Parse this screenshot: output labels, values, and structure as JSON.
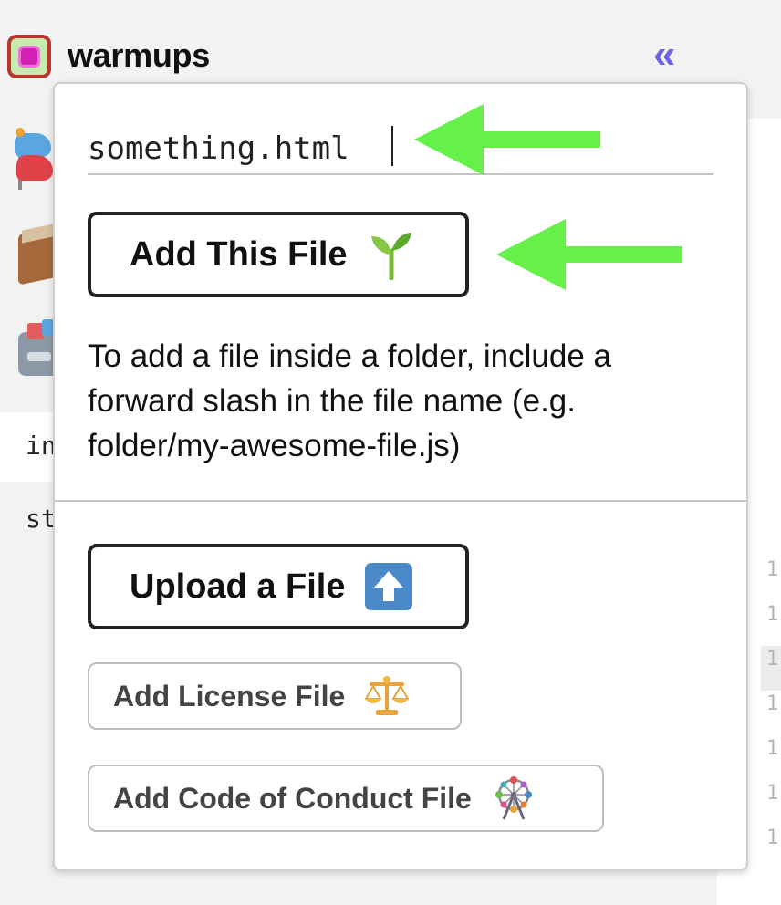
{
  "project": {
    "name": "warmups"
  },
  "sidebar": {
    "files": [
      "in",
      "st"
    ]
  },
  "editor": {
    "line_numbers": [
      "1",
      "1",
      "1",
      "1",
      "1",
      "1",
      "1"
    ]
  },
  "popover": {
    "filename_value": "something.html",
    "add_button_label": "Add This File",
    "add_button_icon": "seedling-icon",
    "help_text": "To add a file inside a folder, include a forward slash in the file name (e.g. folder/my-awesome-file.js)",
    "upload_button_label": "Upload a File",
    "upload_button_icon": "up-arrow-icon",
    "license_button_label": "Add License File",
    "license_button_icon": "balance-scale-icon",
    "coc_button_label": "Add Code of Conduct File",
    "coc_button_icon": "ferris-wheel-icon"
  },
  "colors": {
    "annotation_arrow": "#66f04a",
    "collapse_icon": "#6c63e0",
    "upload_icon_bg": "#4a88c8"
  }
}
